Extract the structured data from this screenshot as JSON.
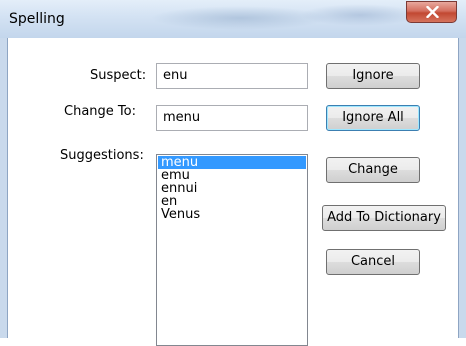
{
  "window": {
    "title": "Spelling"
  },
  "form": {
    "suspect_label": "Suspect:",
    "suspect_value": "enu",
    "change_to_label": "Change To:",
    "change_to_value": "menu",
    "suggestions_label": "Suggestions:"
  },
  "suggestions": [
    "menu",
    "emu",
    "ennui",
    "en",
    "Venus"
  ],
  "selected_suggestion": "menu",
  "buttons": {
    "ignore": "Ignore",
    "ignore_all": "Ignore All",
    "change": "Change",
    "add_to_dictionary": "Add To Dictionary",
    "cancel": "Cancel"
  },
  "colors": {
    "selection": "#3399ff",
    "close_button": "#c24832"
  },
  "icons": {
    "close": "close-icon"
  }
}
